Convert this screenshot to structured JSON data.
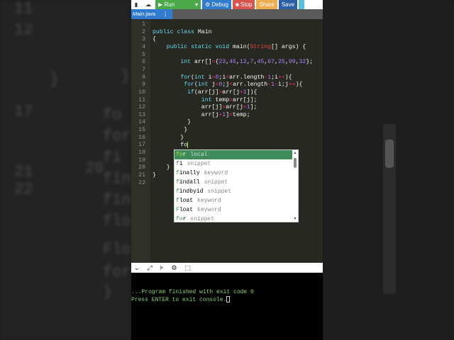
{
  "toolbar": {
    "run": "▶ Run",
    "run_dropdown": "▾",
    "debug": "⚙ Debug",
    "stop": "■ Stop",
    "share": "Share",
    "save": "Save",
    "colors": {
      "run": "#4aaa4a",
      "debug": "#2f7bd0",
      "stop": "#d9534f",
      "share": "#f0ad4e",
      "save": "#2a5fa6"
    }
  },
  "tab": {
    "label": "Main.java",
    "menu": "⋮"
  },
  "code_lines": [
    {
      "n": "1",
      "html": ""
    },
    {
      "n": "2",
      "html": "<span class='kw'>public</span> <span class='kw'>class</span> Main"
    },
    {
      "n": "3",
      "html": "{"
    },
    {
      "n": "4",
      "html": "    <span class='kw'>public</span> <span class='kw'>static</span> <span class='kw'>void</span> main(<span class='str'>String</span>[] args) {"
    },
    {
      "n": "5",
      "html": ""
    },
    {
      "n": "6",
      "html": "        <span class='ty'>int</span> arr[]<span class='op'>=</span>{<span class='num'>23</span>,<span class='num'>45</span>,<span class='num'>12</span>,<span class='num'>7</span>,<span class='num'>45</span>,<span class='num'>67</span>,<span class='num'>25</span>,<span class='num'>99</span>,<span class='num'>32</span>};"
    },
    {
      "n": "7",
      "html": ""
    },
    {
      "n": "8",
      "html": "        <span class='kw'>for</span>(<span class='ty'>int</span> i<span class='op'>=</span><span class='num'>0</span>;i<span class='op'>&lt;</span>arr.length<span class='op'>-</span><span class='num'>1</span>;i<span class='op'>++</span>){"
    },
    {
      "n": "9",
      "html": "         <span class='kw'>for</span>(<span class='ty'>int</span> j<span class='op'>=</span><span class='num'>0</span>;j<span class='op'>&lt;</span>arr.length<span class='op'>-</span><span class='num'>1</span><span class='op'>-</span>i;j<span class='op'>++</span>){"
    },
    {
      "n": "10",
      "html": "          <span class='kw'>if</span>(arr[j]<span class='op'>&gt;</span>arr[j<span class='op'>+</span><span class='num'>1</span>]){"
    },
    {
      "n": "11",
      "html": "              <span class='ty'>int</span> temp<span class='op'>=</span>arr[j];"
    },
    {
      "n": "12",
      "html": "              arr[j]<span class='op'>=</span>arr[j<span class='op'>+</span><span class='num'>1</span>];"
    },
    {
      "n": "13",
      "html": "              arr[j<span class='op'>+</span><span class='num'>1</span>]<span class='op'>=</span>temp;"
    },
    {
      "n": "14",
      "html": "          }"
    },
    {
      "n": "15",
      "html": "         }"
    },
    {
      "n": "16",
      "html": "        }"
    },
    {
      "n": "17",
      "html": "        fo<span class='cursor'></span>"
    },
    {
      "n": "18",
      "html": ""
    },
    {
      "n": "19",
      "html": ""
    },
    {
      "n": "20",
      "html": "    }"
    },
    {
      "n": "21",
      "html": "}"
    },
    {
      "n": "22",
      "html": ""
    }
  ],
  "autocomplete": [
    {
      "m": "fo",
      "rest": "r",
      "meta": "local"
    },
    {
      "m": "f",
      "rest": "i",
      "meta": "snippet"
    },
    {
      "m": "f",
      "rest": "inally",
      "meta": "keyword"
    },
    {
      "m": "f",
      "rest": "indall",
      "meta": "snippet"
    },
    {
      "m": "f",
      "rest": "indbyid",
      "meta": "snippet"
    },
    {
      "m": "f",
      "rest": "loat",
      "meta": "keyword"
    },
    {
      "m": "F",
      "rest": "loat",
      "meta": "keyword"
    },
    {
      "m": "fo",
      "rest": "r",
      "meta": "snippet"
    }
  ],
  "bottombar": {
    "collapse": "⌄",
    "expand": "⤢",
    "format": "⊧",
    "settings": "⚙",
    "clear": "⬚"
  },
  "console": {
    "line1": "...Program finished with exit code 0",
    "line2": "Press ENTER to exit console."
  },
  "background_left": [
    "11",
    "12",
    "}",
    "17",
    "fo",
    "for",
    "fi",
    "fin",
    "fin",
    "flo",
    "Flo",
    "for",
    "}",
    "20",
    "21",
    "22",
    "}"
  ]
}
